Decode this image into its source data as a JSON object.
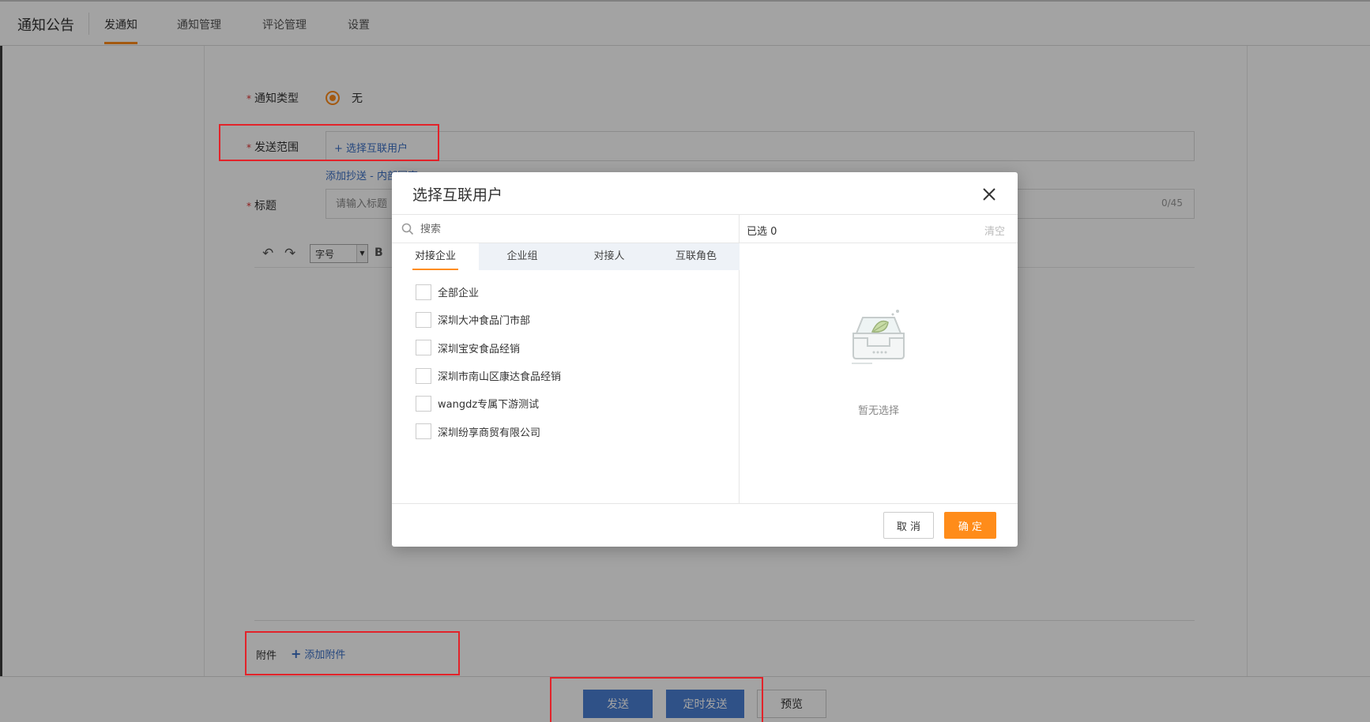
{
  "app": {
    "title": "通知公告"
  },
  "nav": {
    "tabs": [
      {
        "label": "发通知"
      },
      {
        "label": "通知管理"
      },
      {
        "label": "评论管理"
      },
      {
        "label": "设置"
      }
    ]
  },
  "form": {
    "notice_type": {
      "label": "通知类型",
      "required_mark": "*",
      "option": "无"
    },
    "scope": {
      "label": "发送范围",
      "required_mark": "*",
      "link": "+ 选择互联用户"
    },
    "cc_link": "添加抄送 - 内部同事",
    "title": {
      "label": "标题",
      "required_mark": "*",
      "placeholder": "请输入标题",
      "count": "0/45"
    },
    "editor": {
      "font_size_select": "字号",
      "bold": "B"
    },
    "attachment": {
      "label": "附件",
      "add_icon": "+",
      "link": "添加附件"
    }
  },
  "footer": {
    "send": "发送",
    "scheduled_send": "定时发送",
    "preview": "预览"
  },
  "modal": {
    "title": "选择互联用户",
    "search_placeholder": "搜索",
    "tabs": [
      {
        "label": "对接企业"
      },
      {
        "label": "企业组"
      },
      {
        "label": "对接人"
      },
      {
        "label": "互联角色"
      }
    ],
    "options": [
      {
        "label": "全部企业"
      },
      {
        "label": "深圳大冲食品门市部"
      },
      {
        "label": "深圳宝安食品经销"
      },
      {
        "label": "深圳市南山区康达食品经销"
      },
      {
        "label": "wangdz专属下游测试"
      },
      {
        "label": "深圳纷享商贸有限公司"
      }
    ],
    "selected_count": "已选 0",
    "clear": "清空",
    "empty_text": "暂无选择",
    "cancel": "取 消",
    "confirm": "确 定"
  },
  "colors": {
    "accent": "#ff8c1a",
    "link": "#3b6fc6",
    "primary_button": "#4a7fd4",
    "highlight_box": "#e2232a"
  }
}
